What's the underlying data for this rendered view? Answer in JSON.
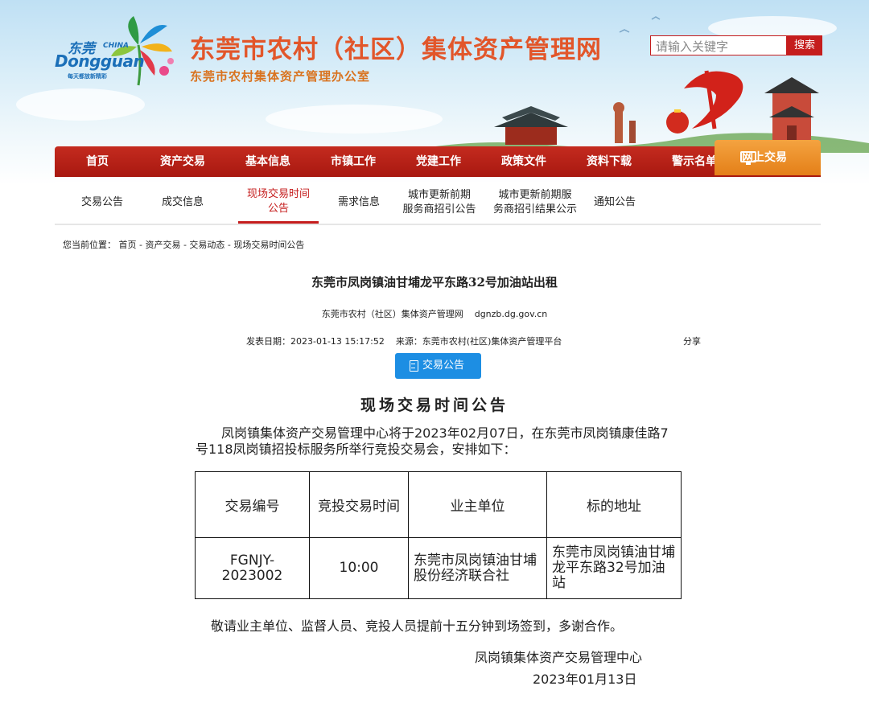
{
  "header": {
    "logo_cn": "东莞",
    "logo_china": "CHINA",
    "logo_en": "Dongguan",
    "logo_slogan": "每天都放新精彩",
    "site_title": "东莞市农村（社区）集体资产管理网",
    "site_subtitle": "东莞市农村集体资产管理办公室",
    "search_placeholder": "请输入关键字",
    "search_button": "搜索"
  },
  "nav": {
    "items": [
      "首页",
      "资产交易",
      "基本信息",
      "市镇工作",
      "党建工作",
      "政策文件",
      "资料下载",
      "警示名单"
    ],
    "online": "网上交易"
  },
  "subnav": {
    "items": [
      {
        "line1": "交易公告",
        "line2": ""
      },
      {
        "line1": "成交信息",
        "line2": ""
      },
      {
        "line1": "现场交易时间",
        "line2": "公告"
      },
      {
        "line1": "需求信息",
        "line2": ""
      },
      {
        "line1": "城市更新前期",
        "line2": "服务商招引公告"
      },
      {
        "line1": "城市更新前期服",
        "line2": "务商招引结果公示"
      },
      {
        "line1": "通知公告",
        "line2": ""
      }
    ]
  },
  "breadcrumb": "您当前位置：  首页 - 资产交易 - 交易动态 - 现场交易时间公告",
  "article": {
    "title": "东莞市凤岗镇油甘埔龙平东路32号加油站出租",
    "source_line": "东莞市农村（社区）集体资产管理网    dgnzb.dg.gov.cn",
    "meta": "发表日期：2023-01-13 15:17:52    来源：东莞市农村(社区)集体资产管理平台",
    "share": "分享",
    "tag_button": "交易公告"
  },
  "notice": {
    "title": "现场交易时间公告",
    "intro": "凤岗镇集体资产交易管理中心将于2023年02月07日，在东莞市凤岗镇康佳路7号118凤岗镇招投标服务所举行竞投交易会，安排如下：",
    "table": {
      "headers": [
        "交易编号",
        "竞投交易时间",
        "业主单位",
        "标的地址"
      ],
      "row": [
        "FGNJY-2023002",
        "10:00",
        "东莞市凤岗镇油甘埔股份经济联合社",
        "东莞市凤岗镇油甘埔龙平东路32号加油站"
      ]
    },
    "closing": "敬请业主单位、监督人员、竞投人员提前十五分钟到场签到，多谢合作。",
    "signature": "凤岗镇集体资产交易管理中心",
    "date": "2023年01月13日"
  },
  "colors": {
    "nav_red": "#b5201a",
    "online_orange": "#ec8a22",
    "title_orange": "#e2562a",
    "tag_blue": "#1d8ee3"
  }
}
